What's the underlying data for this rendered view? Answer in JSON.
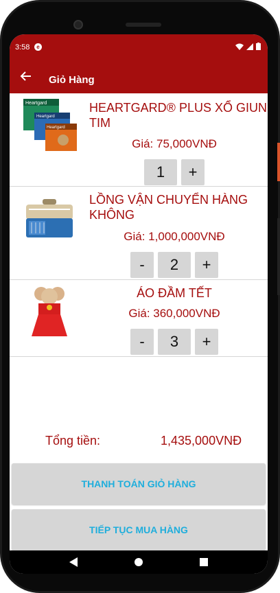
{
  "status_bar": {
    "time": "3:58",
    "app_icon": "app-notification-icon"
  },
  "app_bar": {
    "title": "Giỏ Hàng",
    "back_icon": "arrow-back-icon"
  },
  "cart": {
    "items": [
      {
        "name": "HEARTGARD® PLUS XỔ GIUN TIM",
        "price": "Giá: 75,000VNĐ",
        "quantity": "1",
        "show_minus": false
      },
      {
        "name": "LỒNG VẬN CHUYỂN HÀNG KHÔNG",
        "price": "Giá: 1,000,000VNĐ",
        "quantity": "2",
        "show_minus": true
      },
      {
        "name": "ÁO ĐẦM TẾT",
        "price": "Giá: 360,000VNĐ",
        "quantity": "3",
        "show_minus": true
      }
    ],
    "minus_label": "-",
    "plus_label": "+"
  },
  "total": {
    "label": "Tổng tiền:",
    "value": "1,435,000VNĐ"
  },
  "actions": {
    "checkout_label": "THANH TOÁN GIỎ HÀNG",
    "continue_label": "TIẾP TỤC MUA HÀNG"
  },
  "colors": {
    "primary": "#a50e0e",
    "button_bg": "#d6d6d6",
    "button_text": "#1faedc"
  }
}
